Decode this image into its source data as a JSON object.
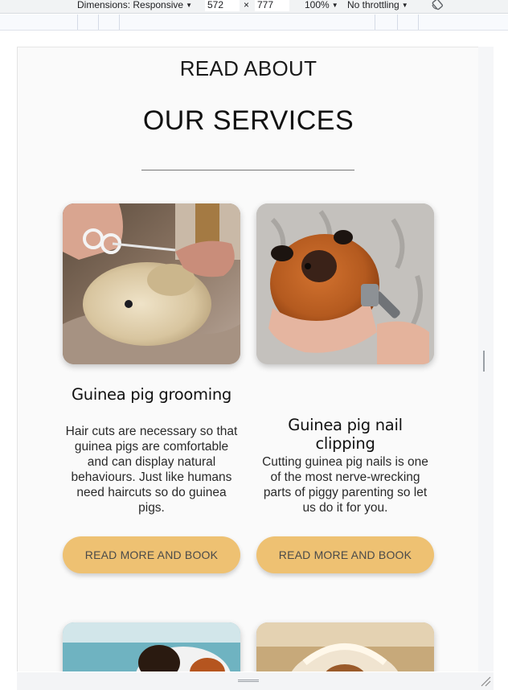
{
  "devtools": {
    "dimensions_label": "Dimensions: Responsive",
    "width_value": "572",
    "times": "×",
    "height_value": "777",
    "zoom": "100%",
    "throttling": "No throttling",
    "caret": "▼"
  },
  "page": {
    "eyebrow": "READ ABOUT",
    "title": "OUR SERVICES",
    "accent_color": "#eec172",
    "cards": [
      {
        "image_icon": "guinea-pig-grooming-photo",
        "title": "Guinea pig grooming",
        "text": "Hair cuts are necessary so that guinea pigs are comfortable and can display natural behaviours. Just like humans need haircuts so do guinea pigs.",
        "button": "READ MORE AND BOOK"
      },
      {
        "image_icon": "guinea-pig-nail-clipping-photo",
        "title": "Guinea pig nail clipping",
        "text": "Cutting guinea pig nails is one of the most nerve-wrecking parts of piggy parenting so let us do it for you.",
        "button": "READ MORE AND BOOK"
      }
    ]
  }
}
